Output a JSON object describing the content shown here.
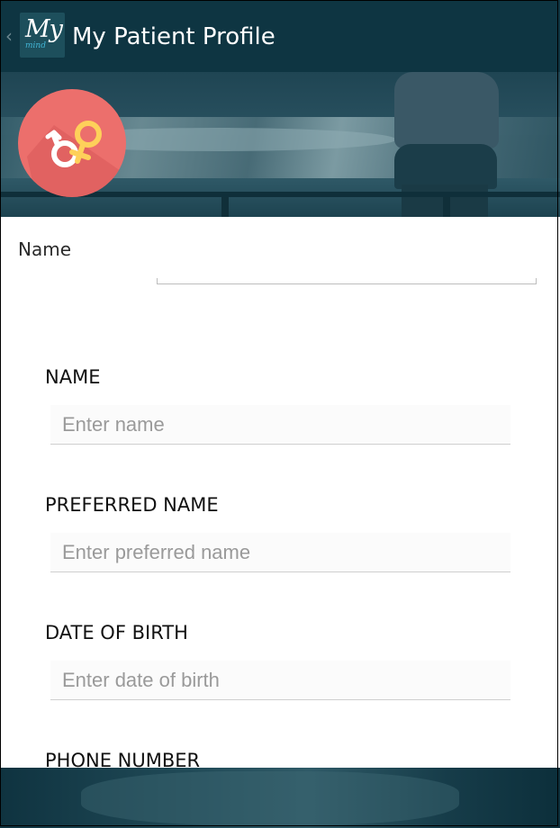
{
  "appbar": {
    "title": "My Patient Profile",
    "logo_main": "My",
    "logo_sub": "mind",
    "back_icon": "chevron-left-icon",
    "color": "#0e3542"
  },
  "banner": {
    "badge_icon": "gender-male-female-icon",
    "badge_color": "#ec6f6c"
  },
  "profile": {
    "name_label": "Name",
    "name_value": ""
  },
  "form": {
    "fields": [
      {
        "label": "NAME",
        "placeholder": "Enter name",
        "value": ""
      },
      {
        "label": "PREFERRED NAME",
        "placeholder": "Enter preferred name",
        "value": ""
      },
      {
        "label": "DATE OF BIRTH",
        "placeholder": "Enter date of birth",
        "value": ""
      },
      {
        "label": "PHONE NUMBER"
      }
    ]
  }
}
